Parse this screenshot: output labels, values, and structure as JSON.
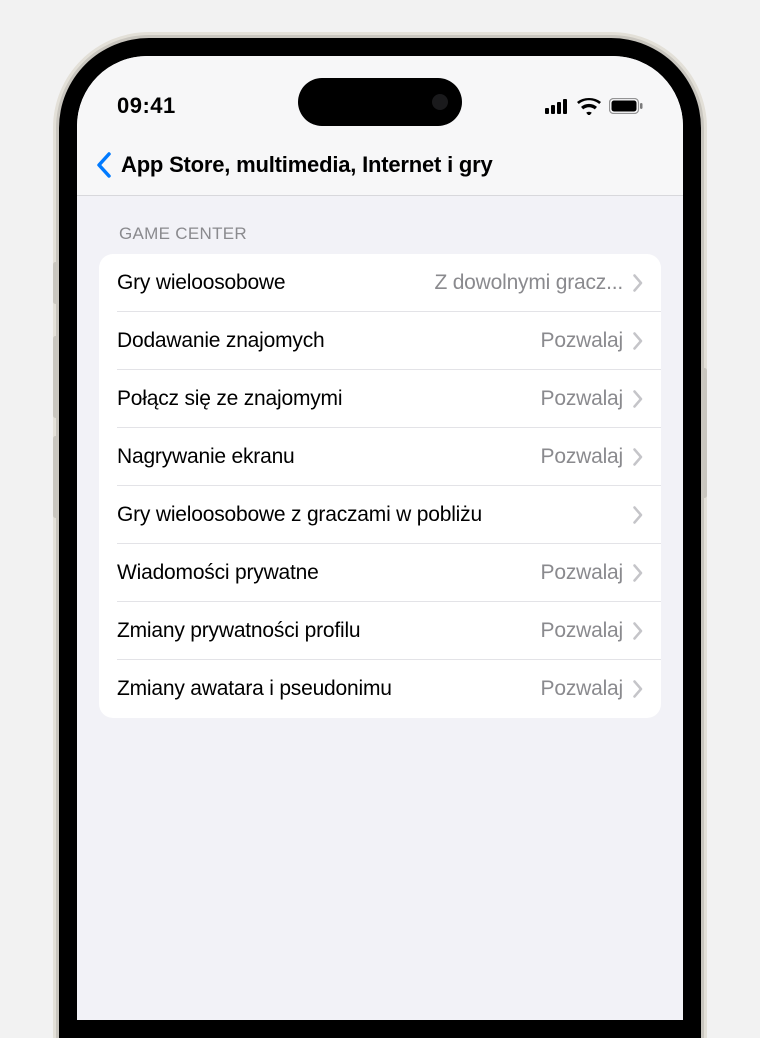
{
  "statusBar": {
    "time": "09:41"
  },
  "nav": {
    "title": "App Store, multimedia, Internet i gry"
  },
  "section": {
    "header": "GAME CENTER",
    "rows": [
      {
        "label": "Gry wieloosobowe",
        "value": "Z dowolnymi gracz..."
      },
      {
        "label": "Dodawanie znajomych",
        "value": "Pozwalaj"
      },
      {
        "label": "Połącz się ze znajomymi",
        "value": "Pozwalaj"
      },
      {
        "label": "Nagrywanie ekranu",
        "value": "Pozwalaj"
      },
      {
        "label": "Gry wieloosobowe z graczami w pobliżu",
        "value": ""
      },
      {
        "label": "Wiadomości prywatne",
        "value": "Pozwalaj"
      },
      {
        "label": "Zmiany prywatności profilu",
        "value": "Pozwalaj"
      },
      {
        "label": "Zmiany awatara i pseudonimu",
        "value": "Pozwalaj"
      }
    ]
  }
}
